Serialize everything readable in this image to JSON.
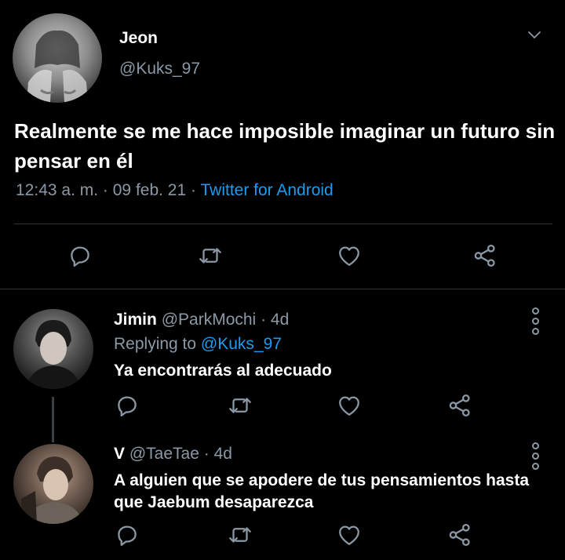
{
  "tweet": {
    "author_name": "Jeon",
    "author_handle": "@Kuks_97",
    "text": "Realmente se me hace imposible imaginar un futuro sin pensar en él",
    "time": "12:43 a. m.",
    "sep1": "·",
    "date": "09 feb. 21",
    "sep2": "·",
    "source": "Twitter for Android"
  },
  "replies": [
    {
      "author_name": "Jimin",
      "author_handle": "@ParkMochi",
      "age": "· 4d",
      "replying_label": "Replying to",
      "replying_handle": "@Kuks_97",
      "text": "Ya encontrarás al adecuado"
    },
    {
      "author_name": "V",
      "author_handle": "@TaeTae",
      "age": "· 4d",
      "text": "A alguien que se apodere de tus pensamientos hasta que Jaebum desaparezca"
    }
  ],
  "icons": {
    "reply": "reply-icon",
    "retweet": "retweet-icon",
    "like": "heart-icon",
    "share": "share-icon",
    "more": "more-vertical-icon",
    "menu": "chevron-down-icon"
  },
  "colors": {
    "background": "#000000",
    "text": "#ffffff",
    "muted": "#8b98a5",
    "link": "#1d9bf0",
    "divider": "#2f3336"
  }
}
